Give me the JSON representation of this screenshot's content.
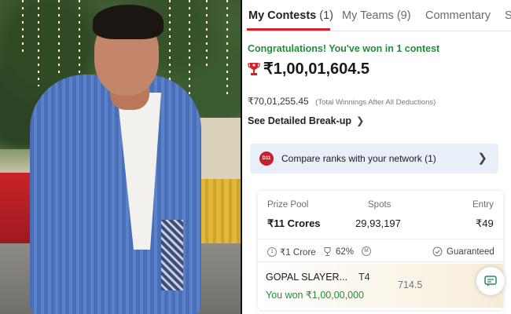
{
  "tabs": [
    {
      "label": "My Contests",
      "count": "(1)",
      "active": true
    },
    {
      "label": "My Teams",
      "count": "(9)",
      "active": false
    },
    {
      "label": "Commentary",
      "count": "",
      "active": false
    },
    {
      "label": "S",
      "count": "",
      "active": false
    }
  ],
  "winning": {
    "congrats": "Congratulations! You've won in 1 contest",
    "amount": "₹1,00,01,604.5",
    "net_amount": "₹70,01,255.45",
    "net_note": "(Total Winnings After All Deductions)",
    "breakup_label": "See Detailed Break-up"
  },
  "compare": {
    "logo_text": "D11",
    "label": "Compare ranks with your network (1)"
  },
  "contest": {
    "headers": {
      "prize_pool": "Prize Pool",
      "spots": "Spots",
      "entry": "Entry"
    },
    "prize_pool": "₹11 Crores",
    "spots": "29,93,197",
    "entry": "₹49",
    "meta": {
      "first_prize": "₹1 Crore",
      "winners_pct": "62%",
      "guaranteed": "Guaranteed"
    },
    "team_name": "GOPAL SLAYER...",
    "team_tag": "T4",
    "points": "714.5",
    "won": "You won ₹1,00,00,000"
  },
  "colors": {
    "accent_red": "#d3222a",
    "win_green": "#1f8f3a",
    "compare_bg": "#e8eff8"
  },
  "icons": [
    "trophy-icon",
    "chevron-right-icon",
    "medal-icon",
    "percent-trophy-icon",
    "multi-entry-icon",
    "guaranteed-check-icon",
    "chat-icon"
  ]
}
